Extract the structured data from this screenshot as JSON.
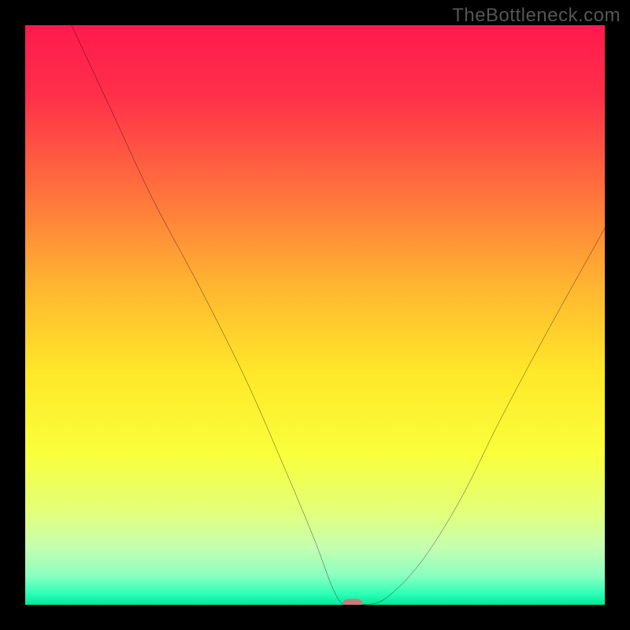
{
  "watermark": "TheBottleneck.com",
  "chart_data": {
    "type": "line",
    "title": "",
    "xlabel": "",
    "ylabel": "",
    "xlim": [
      0,
      100
    ],
    "ylim": [
      0,
      100
    ],
    "grid": false,
    "legend": false,
    "series": [
      {
        "name": "bottleneck-curve",
        "x": [
          8,
          15,
          22,
          30,
          38,
          45,
          50,
          53,
          55,
          58,
          62,
          68,
          75,
          82,
          90,
          100
        ],
        "values": [
          100,
          85,
          70,
          55,
          39,
          23,
          11,
          3,
          0,
          0,
          1,
          7,
          18,
          32,
          47,
          65
        ]
      }
    ],
    "annotations": [
      {
        "name": "optimal-marker",
        "x": 56.5,
        "y": 0
      }
    ],
    "background_gradient_stops": [
      {
        "pos": 0,
        "color": "#ff1a4d"
      },
      {
        "pos": 12,
        "color": "#ff2f4a"
      },
      {
        "pos": 28,
        "color": "#ff6e3e"
      },
      {
        "pos": 45,
        "color": "#ffb531"
      },
      {
        "pos": 60,
        "color": "#ffe829"
      },
      {
        "pos": 74,
        "color": "#f9ff3b"
      },
      {
        "pos": 84,
        "color": "#e3ff7a"
      },
      {
        "pos": 90,
        "color": "#c6ffb0"
      },
      {
        "pos": 95,
        "color": "#8affc0"
      },
      {
        "pos": 98,
        "color": "#30ffb7"
      },
      {
        "pos": 100,
        "color": "#00e89a"
      }
    ]
  }
}
